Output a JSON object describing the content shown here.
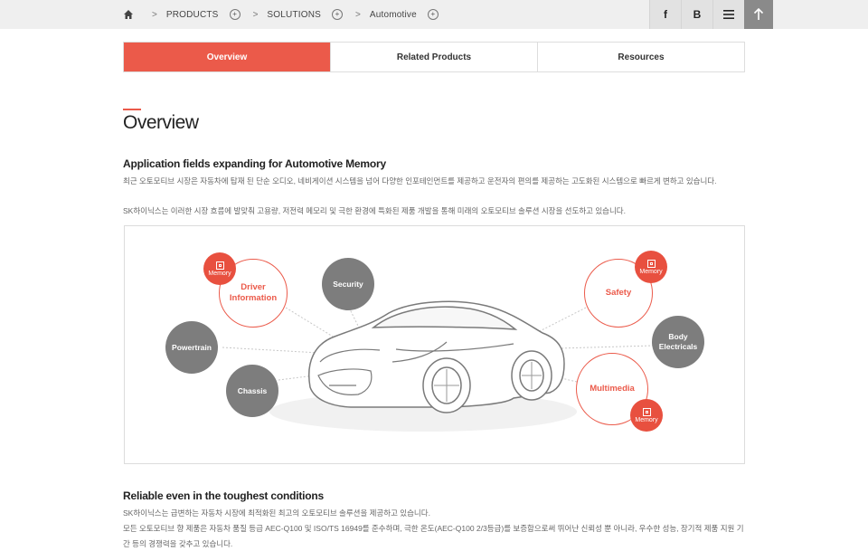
{
  "breadcrumb": {
    "home_icon": "home-icon",
    "items": [
      "PRODUCTS",
      "SOLUTIONS",
      "Automotive"
    ],
    "separator": ">",
    "expand_glyph": "+"
  },
  "toolbar": {
    "facebook": "f",
    "blog": "B",
    "menu_icon": "menu-icon",
    "top_icon": "arrow-up-icon"
  },
  "tabs": [
    {
      "label": "Overview",
      "active": true
    },
    {
      "label": "Related Products",
      "active": false
    },
    {
      "label": "Resources",
      "active": false
    }
  ],
  "page_title": "Overview",
  "section1": {
    "heading": "Application fields expanding for Automotive Memory",
    "para1": "최근 오토모티브 시장은 자동차에 탑재 된 단순 오디오, 네비게이션 시스템을 넘어 다양한 인포테인먼트를 제공하고 운전자의 편의를 제공하는 고도화된 시스템으로 빠르게 변하고 있습니다.",
    "para2": "SK하이닉스는 이러한 시장 흐름에 발맞춰 고용량, 저전력 메모리 및 극한 환경에 특화된 제품 개발을 통해 미래의 오토모티브 솔루션 시장을 선도하고 있습니다."
  },
  "diagram": {
    "accent": "#eb5a4a",
    "gray": "#7d7d7d",
    "labels": {
      "driver_info": "Driver\nInformation",
      "security": "Security",
      "powertrain": "Powertrain",
      "chassis": "Chassis",
      "safety": "Safety",
      "body": "Body\nElectricals",
      "multimedia": "Multimedia"
    },
    "memory_badge": "Memory"
  },
  "section2": {
    "heading": "Reliable even in the toughest conditions",
    "para1": "SK하이닉스는 급변하는 자동차 시장에 최적화된 최고의 오토모티브 솔루션을 제공하고 있습니다.",
    "para2": "모든 오토모티브 향 제품은 자동차 품질 등급 AEC-Q100 및 ISO/TS 16949를 준수하며, 극한 온도(AEC-Q100 2/3등급)를 보증함으로써 뛰어난 신뢰성 뿐 아니라, 우수한 성능, 장기적 제품 지원 기간 등의 경쟁력을 갖추고 있습니다."
  }
}
